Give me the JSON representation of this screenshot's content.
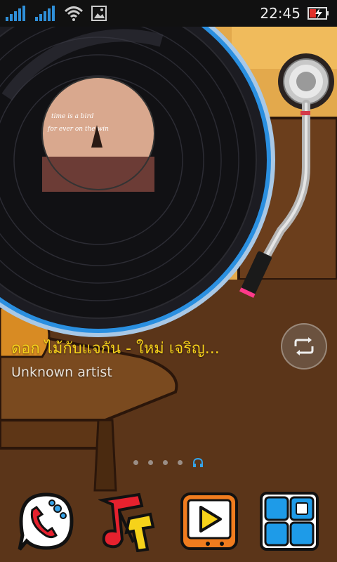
{
  "status_bar": {
    "time": "22:45",
    "icons": [
      "signal-1-icon",
      "signal-2-icon",
      "wifi-icon",
      "image-notification-icon",
      "battery-charging-icon"
    ],
    "battery_color": "#e0312b"
  },
  "now_playing": {
    "title": "ดอก ไม้กับแจกัน - ใหม่ เจริญ...",
    "artist": "Unknown artist",
    "album_art_text": [
      "time is a bird",
      "for ever on the win"
    ],
    "title_color": "#f7d21a"
  },
  "controls": {
    "repeat_icon": "repeat-icon"
  },
  "home_pages": {
    "count": 5,
    "current_icon": "headphones-icon"
  },
  "dock": {
    "items": [
      {
        "icon": "phone-icon"
      },
      {
        "icon": "music-icon"
      },
      {
        "icon": "video-player-icon"
      },
      {
        "icon": "app-grid-icon"
      }
    ]
  }
}
